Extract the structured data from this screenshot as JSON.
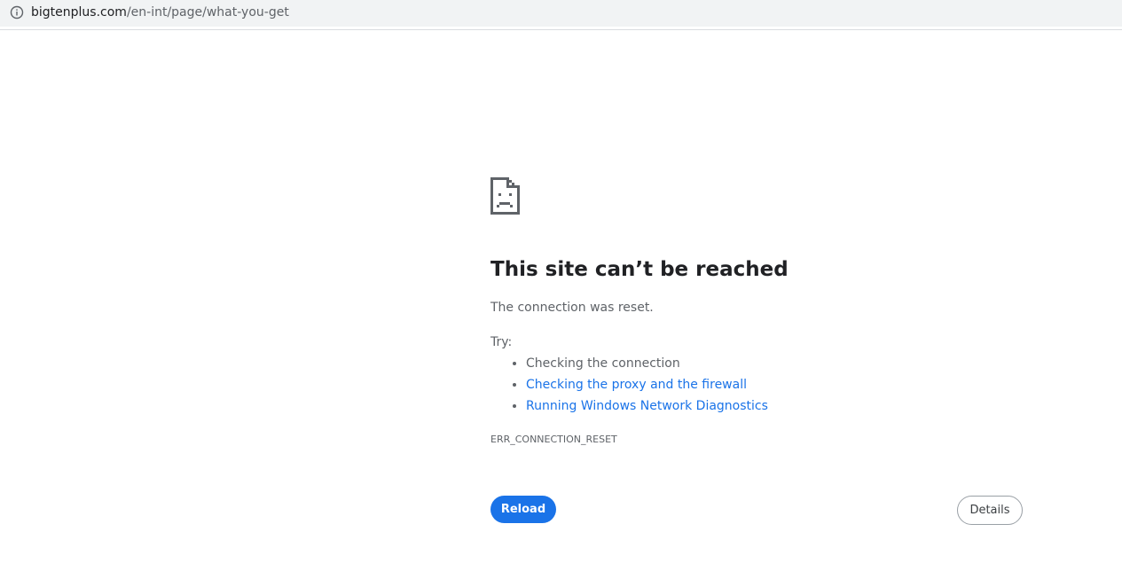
{
  "address_bar": {
    "domain": "bigtenplus.com",
    "path": "/en-int/page/what-you-get",
    "icon": "info-icon"
  },
  "error_page": {
    "icon": "sad-document-icon",
    "title": "This site can’t be reached",
    "description": "The connection was reset.",
    "try_label": "Try:",
    "suggestions": [
      {
        "label": "Checking the connection",
        "is_link": false
      },
      {
        "label": "Checking the proxy and the firewall",
        "is_link": true
      },
      {
        "label": "Running Windows Network Diagnostics",
        "is_link": true
      }
    ],
    "error_code": "ERR_CONNECTION_RESET",
    "reload_label": "Reload",
    "details_label": "Details"
  },
  "colors": {
    "accent": "#1a73e8",
    "text_primary": "#202124",
    "text_secondary": "#5f6368",
    "addressbar_bg": "#f1f3f4"
  }
}
